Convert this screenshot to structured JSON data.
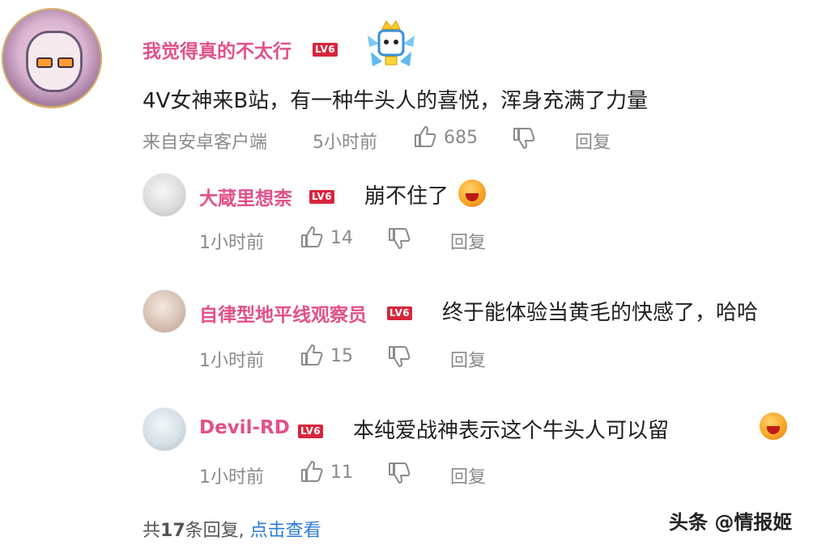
{
  "main_comment": {
    "username": "我觉得真的不太行",
    "level": "LV6",
    "content": "4V女神来B站，有一种牛头人的喜悦，浑身充满了力量",
    "device": "来自安卓客户端",
    "time": "5小时前",
    "likes": "685",
    "reply_label": "回复"
  },
  "replies": [
    {
      "username": "大蔵里想柰",
      "level": "LV6",
      "content": "崩不住了",
      "time": "1小时前",
      "likes": "14",
      "reply_label": "回复"
    },
    {
      "username": "自律型地平线观察员",
      "level": "LV6",
      "content": "终于能体验当黄毛的快感了，哈哈",
      "time": "1小时前",
      "likes": "15",
      "reply_label": "回复"
    },
    {
      "username": "Devil-RD",
      "level": "LV6",
      "content": "本纯爱战神表示这个牛头人可以留",
      "time": "1小时前",
      "likes": "11",
      "reply_label": "回复"
    }
  ],
  "footer": {
    "total_prefix": "共",
    "total_count": "17",
    "total_suffix": "条回复,",
    "view_link": "点击查看"
  },
  "watermark": "头条 @情报姬",
  "colors": {
    "username": "#e2508a",
    "level_badge": "#d7263d",
    "meta_text": "#8a8a8a",
    "link": "#2b7bd8"
  },
  "icons": [
    "avatar",
    "level-badge",
    "mascot-badge",
    "thumbs-up-icon",
    "thumbs-down-icon",
    "emoji"
  ]
}
